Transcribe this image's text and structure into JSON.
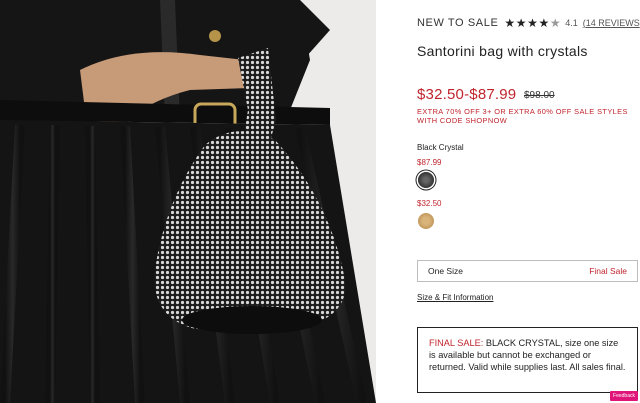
{
  "product": {
    "badge": "NEW TO SALE",
    "rating": "4.1",
    "stars": {
      "filled": 4,
      "total": 5
    },
    "reviews_link": "14 REVIEWS",
    "title": "Santorini bag with crystals",
    "price_range": "$32.50-$87.99",
    "original_price": "$98.00",
    "promo_text": "EXTRA 70% OFF 3+ OR EXTRA 60% OFF SALE STYLES WITH CODE SHOPNOW"
  },
  "colors": {
    "selected_name": "Black Crystal",
    "options": [
      {
        "price": "$87.99",
        "swatch": "black-crystal",
        "color": "#333333"
      },
      {
        "price": "$32.50",
        "swatch": "gold",
        "color": "#c9a063"
      }
    ]
  },
  "size": {
    "label": "One Size",
    "tag": "Final Sale"
  },
  "size_fit_link": "Size & Fit Information",
  "notice": {
    "prefix": "FINAL SALE:",
    "body": " BLACK CRYSTAL, size one size is available but cannot be exchanged or returned. Valid while supplies last. All sales final."
  },
  "feedback_tab": "Feedback",
  "theme": {
    "sale_red": "#c0252e",
    "text": "#222222"
  }
}
